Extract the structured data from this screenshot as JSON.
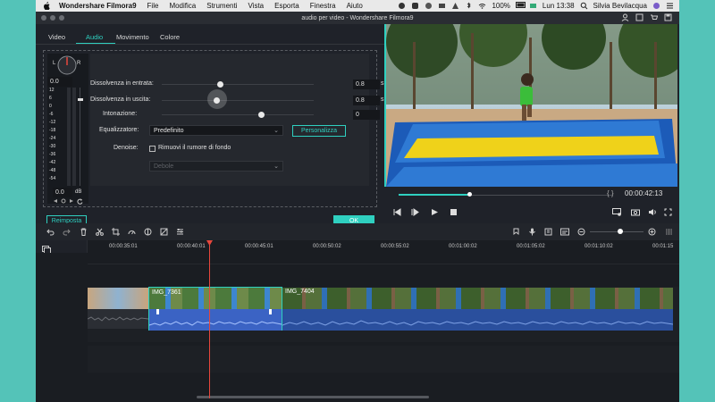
{
  "menubar": {
    "app_name": "Wondershare Filmora9",
    "items": [
      "File",
      "Modifica",
      "Strumenti",
      "Vista",
      "Esporta",
      "Finestra",
      "Aiuto"
    ],
    "battery": "100%",
    "clock": "Lun 13:38",
    "user": "Silvia Bevilacqua"
  },
  "window": {
    "title": "audio per video - Wondershare Filmora9"
  },
  "editor": {
    "tabs": [
      "Video",
      "Audio",
      "Movimento",
      "Colore"
    ],
    "active_tab": "Audio",
    "pan_value": "0.0",
    "meter_labels": [
      "L",
      "R"
    ],
    "meter_scale": [
      "12",
      "6",
      "0",
      "-6",
      "-12",
      "-18",
      "-24",
      "-30",
      "-36",
      "-42",
      "-48",
      "-54"
    ],
    "gain_value": "0.0",
    "gain_unit": "dB",
    "fade_in": {
      "label": "Dissolvenza in entrata:",
      "value": "0.8",
      "unit": "s"
    },
    "fade_out": {
      "label": "Dissolvenza in uscita:",
      "value": "0.8",
      "unit": "s"
    },
    "pitch": {
      "label": "Intonazione:",
      "value": "0"
    },
    "equalizer": {
      "label": "Equalizzatore:",
      "selected": "Predefinito",
      "customize_label": "Personalizza"
    },
    "denoise": {
      "label": "Denoise:",
      "checkbox_label": "Rimuovi il rumore di fondo",
      "level": "Debole"
    },
    "reset_label": "Reimposta",
    "ok_label": "OK"
  },
  "preview": {
    "timecode": "00:00:42:13",
    "progress": 0.33,
    "brackets": "{ }"
  },
  "timeline": {
    "ruler_ticks": [
      "00:00:35:01",
      "00:00:40:01",
      "00:00:45:01",
      "00:00:50:02",
      "00:00:55:02",
      "00:01:00:02",
      "00:01:05:02",
      "00:01:10:02",
      "00:01:15"
    ],
    "clips": [
      {
        "label": ""
      },
      {
        "label": "IMG_7361"
      },
      {
        "label": "IMG_7404"
      }
    ]
  },
  "colors": {
    "accent": "#2fd0c0",
    "playhead": "#e8473c",
    "audio": "#3b63c4",
    "background": "#54c3b8"
  }
}
